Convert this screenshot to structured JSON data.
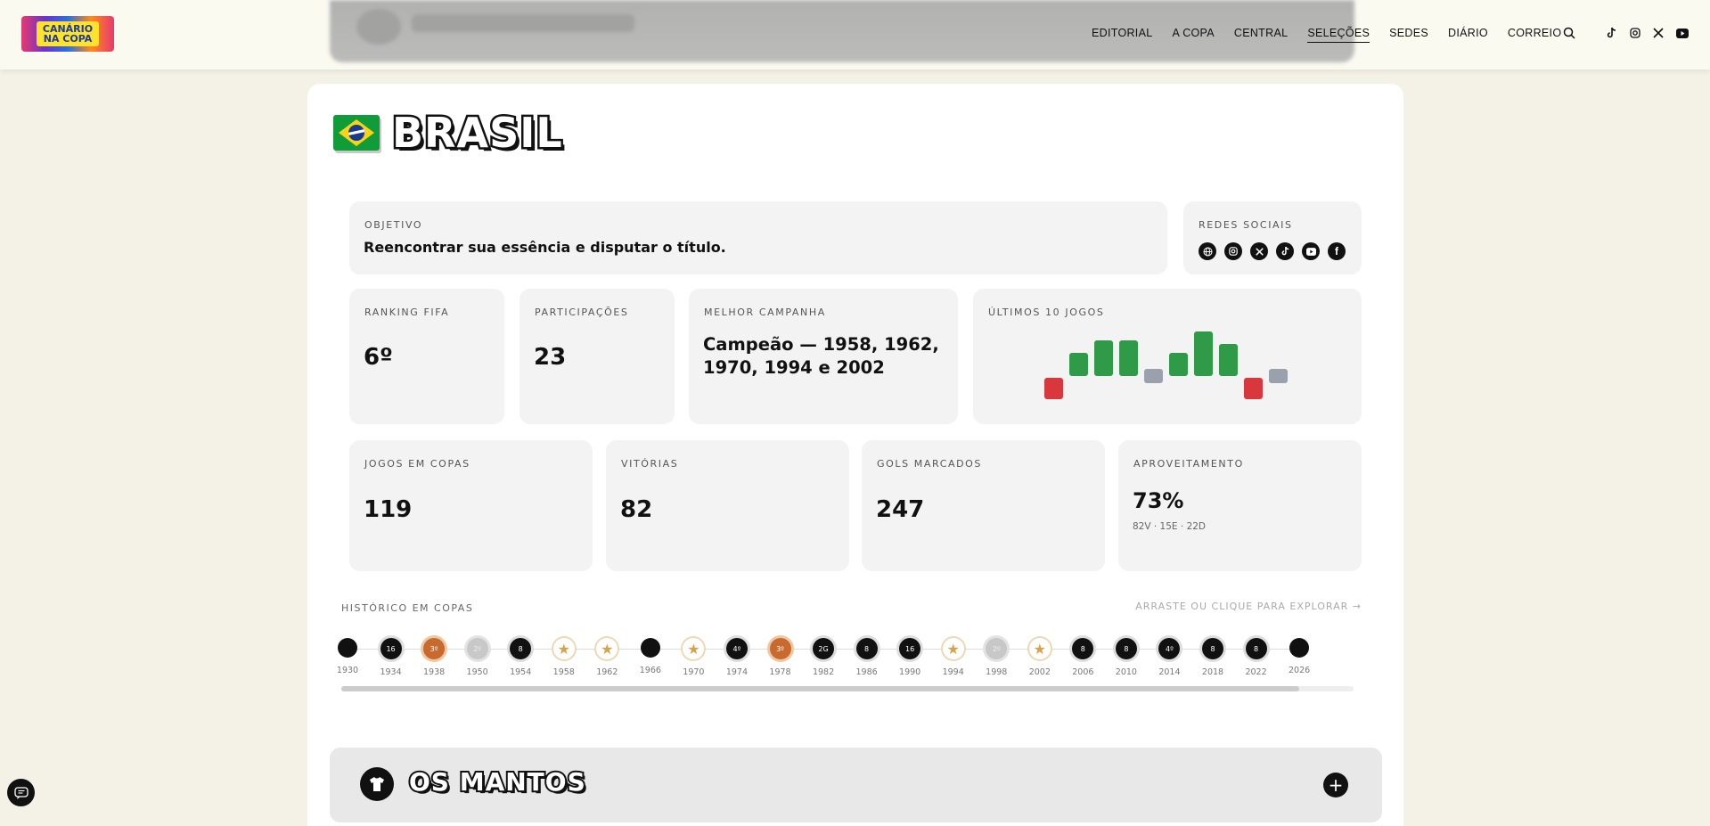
{
  "header": {
    "logo_text_line1": "CANÁRIO",
    "logo_text_line2": "NA COPA",
    "nav": [
      "EDITORIAL",
      "A COPA",
      "CENTRAL",
      "SELEÇÕES",
      "SEDES",
      "DIÁRIO",
      "CORREIO"
    ],
    "active_nav": "SELEÇÕES",
    "icons": [
      "search-icon",
      "tiktok-icon",
      "instagram-icon",
      "x-icon",
      "youtube-icon"
    ]
  },
  "team": {
    "name": "BRASIL",
    "flag": "brazil-flag"
  },
  "objective": {
    "label": "OBJETIVO",
    "text": "Reencontrar sua essência e disputar o título."
  },
  "social": {
    "label": "REDES SOCIAIS",
    "icons": [
      "globe-icon",
      "instagram-icon",
      "x-icon",
      "tiktok-icon",
      "youtube-icon",
      "facebook-icon"
    ]
  },
  "stats": {
    "ranking": {
      "label": "RANKING FIFA",
      "value": "6º"
    },
    "participacoes": {
      "label": "PARTICIPAÇÕES",
      "value": "23"
    },
    "melhor": {
      "label": "MELHOR CAMPANHA",
      "value": "Campeão — 1958, 1962, 1970, 1994 e 2002"
    },
    "ultimos": {
      "label": "ÚLTIMOS 10 JOGOS"
    },
    "jogos": {
      "label": "JOGOS EM COPAS",
      "value": "119"
    },
    "vitorias": {
      "label": "VITÓRIAS",
      "value": "82"
    },
    "gols": {
      "label": "GOLS MARCADOS",
      "value": "247"
    },
    "aproveitamento": {
      "label": "APROVEITAMENTO",
      "value": "73%",
      "record": "82V · 15E · 22D"
    }
  },
  "last_games": [
    "L",
    "W",
    "W",
    "W",
    "D",
    "W",
    "W",
    "W",
    "L",
    "D"
  ],
  "colors": {
    "win": "#2f9a47",
    "loss": "#d9373e",
    "draw": "#9aa1ad"
  },
  "history": {
    "label": "HISTÓRICO EM COPAS",
    "hint": "ARRASTE OU CLIQUE PARA EXPLORAR →",
    "items": [
      {
        "year": "1930",
        "mark": "",
        "kind": "plain"
      },
      {
        "year": "1934",
        "mark": "16",
        "kind": "round"
      },
      {
        "year": "1938",
        "mark": "3º",
        "kind": "third"
      },
      {
        "year": "1950",
        "mark": "2º",
        "kind": "second"
      },
      {
        "year": "1954",
        "mark": "8",
        "kind": "round"
      },
      {
        "year": "1958",
        "mark": "★",
        "kind": "champ"
      },
      {
        "year": "1962",
        "mark": "★",
        "kind": "champ"
      },
      {
        "year": "1966",
        "mark": "",
        "kind": "plain"
      },
      {
        "year": "1970",
        "mark": "★",
        "kind": "champ"
      },
      {
        "year": "1974",
        "mark": "4º",
        "kind": "round"
      },
      {
        "year": "1978",
        "mark": "3º",
        "kind": "third"
      },
      {
        "year": "1982",
        "mark": "2G",
        "kind": "round"
      },
      {
        "year": "1986",
        "mark": "8",
        "kind": "round"
      },
      {
        "year": "1990",
        "mark": "16",
        "kind": "round"
      },
      {
        "year": "1994",
        "mark": "★",
        "kind": "champ"
      },
      {
        "year": "1998",
        "mark": "2º",
        "kind": "second"
      },
      {
        "year": "2002",
        "mark": "★",
        "kind": "champ"
      },
      {
        "year": "2006",
        "mark": "8",
        "kind": "round"
      },
      {
        "year": "2010",
        "mark": "8",
        "kind": "round"
      },
      {
        "year": "2014",
        "mark": "4º",
        "kind": "round"
      },
      {
        "year": "2018",
        "mark": "8",
        "kind": "round"
      },
      {
        "year": "2022",
        "mark": "8",
        "kind": "round"
      },
      {
        "year": "2026",
        "mark": "",
        "kind": "plain"
      }
    ]
  },
  "mantos": {
    "title": "OS MANTOS",
    "toggle": "+"
  }
}
